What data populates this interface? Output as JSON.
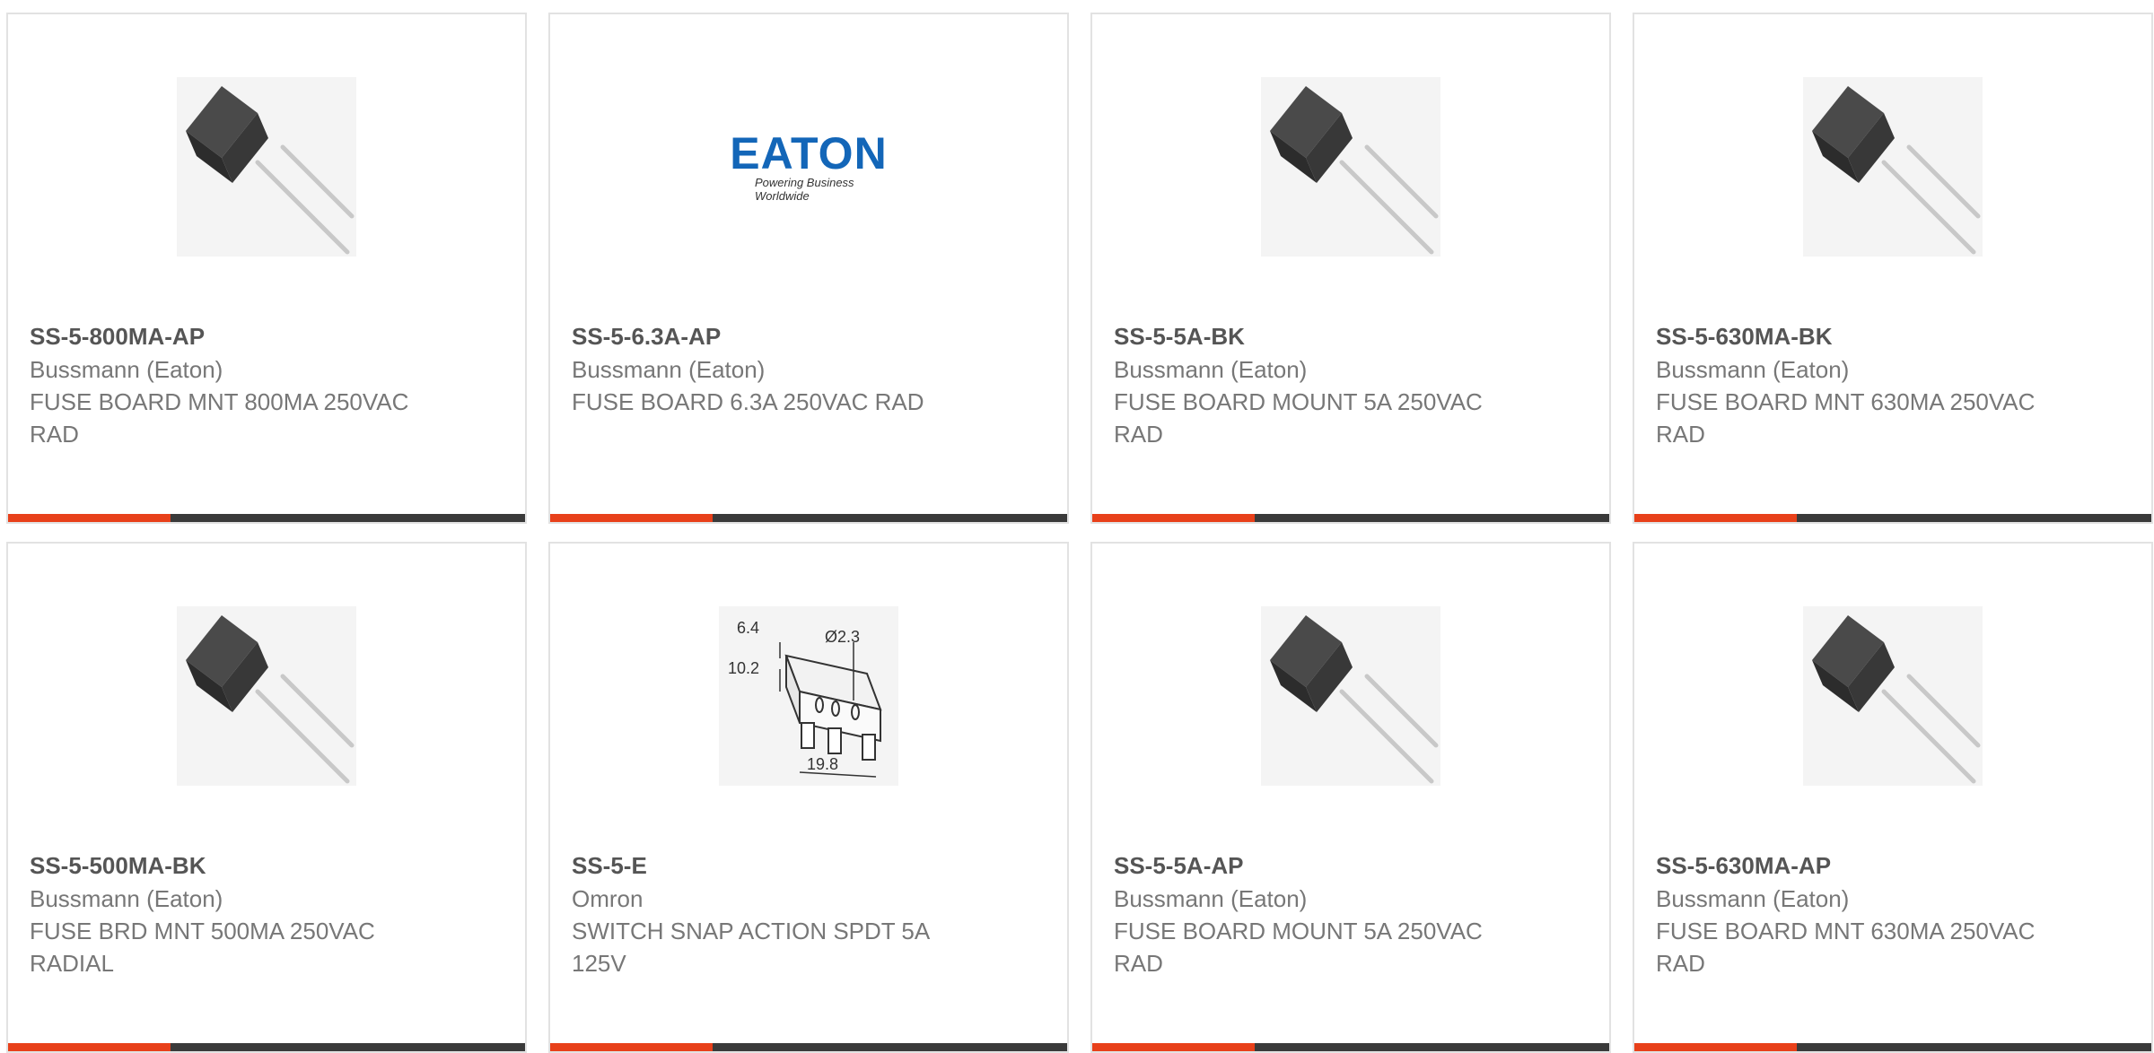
{
  "colors": {
    "accent": "#e8401a",
    "bar": "#3a3a3a",
    "border": "#e2e2e2",
    "eaton_blue": "#1366b8"
  },
  "products": [
    {
      "part_number": "SS-5-800MA-AP",
      "manufacturer": "Bussmann (Eaton)",
      "description": "FUSE BOARD MNT 800MA 250VAC RAD",
      "image": "fuse-icon"
    },
    {
      "part_number": "SS-5-6.3A-AP",
      "manufacturer": "Bussmann (Eaton)",
      "description": "FUSE BOARD 6.3A 250VAC RAD",
      "image": "eaton-logo",
      "logo_word": "EATON",
      "logo_tagline": "Powering Business Worldwide"
    },
    {
      "part_number": "SS-5-5A-BK",
      "manufacturer": "Bussmann (Eaton)",
      "description": "FUSE BOARD MOUNT 5A 250VAC RAD",
      "image": "fuse-icon"
    },
    {
      "part_number": "SS-5-630MA-BK",
      "manufacturer": "Bussmann (Eaton)",
      "description": "FUSE BOARD MNT 630MA 250VAC RAD",
      "image": "fuse-icon"
    },
    {
      "part_number": "SS-5-500MA-BK",
      "manufacturer": "Bussmann (Eaton)",
      "description": "FUSE BRD MNT 500MA 250VAC RADIAL",
      "image": "fuse-icon"
    },
    {
      "part_number": "SS-5-E",
      "manufacturer": "Omron",
      "description": "SWITCH SNAP ACTION SPDT 5A 125V",
      "image": "snap-switch-diagram",
      "dimensions": [
        "6.4",
        "Ø2.3",
        "10.2",
        "19.8"
      ]
    },
    {
      "part_number": "SS-5-5A-AP",
      "manufacturer": "Bussmann (Eaton)",
      "description": "FUSE BOARD MOUNT 5A 250VAC RAD",
      "image": "fuse-icon"
    },
    {
      "part_number": "SS-5-630MA-AP",
      "manufacturer": "Bussmann (Eaton)",
      "description": "FUSE BOARD MNT 630MA 250VAC RAD",
      "image": "fuse-icon"
    }
  ]
}
